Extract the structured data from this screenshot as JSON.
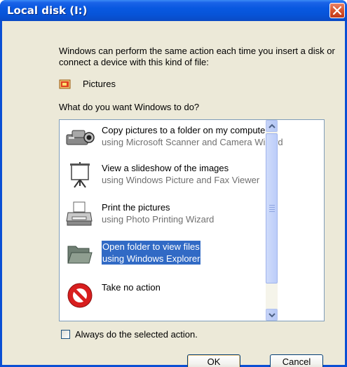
{
  "window": {
    "title": "Local disk (I:)"
  },
  "dialog": {
    "description": "Windows can perform the same action each time you insert a disk or connect a device with this kind of file:",
    "content_type": {
      "icon": "pictures-icon",
      "label": "Pictures"
    },
    "question": "What do you want Windows to do?"
  },
  "actions": {
    "items": [
      {
        "icon": "camera-icon",
        "title": "Copy pictures to a folder on my computer",
        "subtitle": "using Microsoft Scanner and Camera Wizard",
        "selected": false
      },
      {
        "icon": "slideshow-icon",
        "title": "View a slideshow of the images",
        "subtitle": "using Windows Picture and Fax Viewer",
        "selected": false
      },
      {
        "icon": "printer-icon",
        "title": "Print the pictures",
        "subtitle": "using Photo Printing Wizard",
        "selected": false
      },
      {
        "icon": "folder-icon",
        "title": "Open folder to view files",
        "subtitle": "using Windows Explorer",
        "selected": true
      },
      {
        "icon": "no-action-icon",
        "title": "Take no action",
        "subtitle": "",
        "selected": false
      }
    ]
  },
  "options": {
    "always_label": "Always do the selected action.",
    "always_checked": false
  },
  "buttons": {
    "ok": "OK",
    "cancel": "Cancel"
  },
  "colors": {
    "titlebar": "#0858e0",
    "selection": "#316ac5",
    "dialog_bg": "#ece9d8"
  }
}
